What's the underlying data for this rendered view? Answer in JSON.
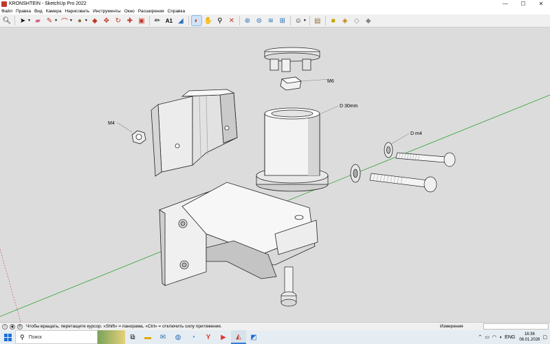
{
  "window": {
    "title": "KRONSHTEIN - SketchUp Pro 2022",
    "minimize": "—",
    "maximize": "☐",
    "close": "✕"
  },
  "menu": [
    "Файл",
    "Правка",
    "Вид",
    "Камера",
    "Нарисовать",
    "Инструменты",
    "Окно",
    "Расширения",
    "Справка"
  ],
  "toolbar": {
    "tools": [
      "search-icon",
      "select-arrow-icon",
      "eraser-icon",
      "pencil-icon",
      "arc-icon",
      "shape-icon",
      "push-pull-icon",
      "move-icon",
      "rotate-icon",
      "scale-icon",
      "offset-icon",
      "tape-measure-icon",
      "text-icon",
      "paint-bucket-icon",
      "orbit-icon",
      "pan-icon",
      "zoom-icon",
      "zoom-extents-icon",
      "sandbox-icon",
      "ruby-icon",
      "layers-icon",
      "components-icon",
      "user-icon",
      "warehouse-icon",
      "extension-icon",
      "cube-icon",
      "cube-2-icon",
      "cube-3-icon"
    ]
  },
  "model": {
    "labels": {
      "m6": "M6",
      "d30": "D 30mm",
      "dm4": "D m4",
      "m4": "M4"
    }
  },
  "status": {
    "hint": "Чтобы вращать, перетащите курсор. «Shift» = панорама, «Ctrl» = отключить силу притяжения.",
    "measurements_label": "Измерения",
    "measurements_value": ""
  },
  "taskbar": {
    "search_placeholder": "Поиск",
    "apps": [
      "task-view-icon",
      "file-explorer-icon",
      "mail-icon",
      "browser-icon",
      "edge-icon",
      "yandex-icon",
      "youtube-icon",
      "sketchup-icon",
      "sketchup-2-icon"
    ],
    "language": "ENG",
    "time": "16:36",
    "date": "08.01.2026"
  },
  "colors": {
    "viewport_bg": "#dcdcdc",
    "axis_green": "#2ea12e",
    "axis_red": "#c83c3c",
    "model_face": "#f2f2f2",
    "model_shade": "#b8b8b8"
  }
}
